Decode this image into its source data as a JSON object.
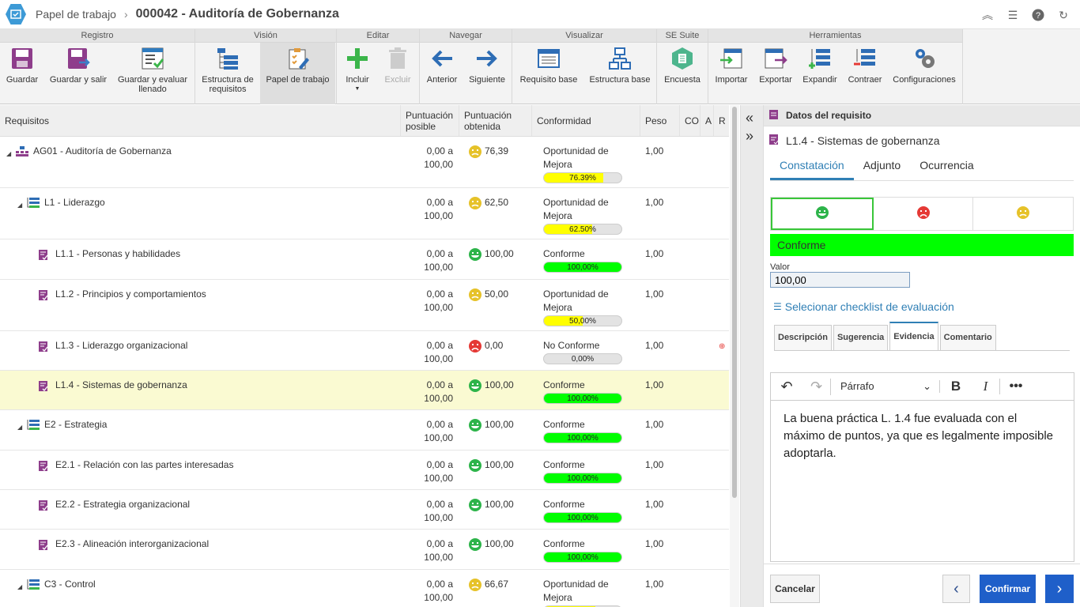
{
  "header": {
    "breadcrumb": "Papel de trabajo",
    "title": "000042 - Auditoría de Gobernanza"
  },
  "ribbon": {
    "groups": [
      "Registro",
      "Visión",
      "Editar",
      "Navegar",
      "Visualizar",
      "SE Suite",
      "Herramientas"
    ],
    "buttons": {
      "guardar": "Guardar",
      "guardar_salir": "Guardar y salir",
      "guardar_evaluar": "Guardar y evaluar llenado",
      "estructura": "Estructura de requisitos",
      "papel": "Papel de trabajo",
      "incluir": "Incluir",
      "excluir": "Excluir",
      "anterior": "Anterior",
      "siguiente": "Siguiente",
      "req_base": "Requisito base",
      "est_base": "Estructura base",
      "encuesta": "Encuesta",
      "importar": "Importar",
      "exportar": "Exportar",
      "expandir": "Expandir",
      "contraer": "Contraer",
      "config": "Configuraciones"
    }
  },
  "table": {
    "headers": {
      "req": "Requisitos",
      "pos": "Puntuación posible",
      "obt": "Puntuación obtenida",
      "conf": "Conformidad",
      "peso": "Peso",
      "co": "CO",
      "a": "A",
      "r": "R"
    },
    "rows": [
      {
        "name": "AG01 - Auditoría de Gobernanza",
        "pos_a": "0,00 a",
        "pos_b": "100,00",
        "obt": "76,39",
        "conf_a": "Oportunidad de",
        "conf_b": "Mejora",
        "pct": "76.39%",
        "peso": "1,00"
      },
      {
        "name": "L1 - Liderazgo",
        "pos_a": "0,00 a",
        "pos_b": "100,00",
        "obt": "62,50",
        "conf_a": "Oportunidad de",
        "conf_b": "Mejora",
        "pct": "62.50%",
        "peso": "1,00"
      },
      {
        "name": "L1.1 - Personas y habilidades",
        "pos_a": "0,00 a",
        "pos_b": "100,00",
        "obt": "100,00",
        "conf_a": "Conforme",
        "pct": "100,00%",
        "peso": "1,00"
      },
      {
        "name": "L1.2 - Principios y comportamientos",
        "pos_a": "0,00 a",
        "pos_b": "100,00",
        "obt": "50,00",
        "conf_a": "Oportunidad de",
        "conf_b": "Mejora",
        "pct": "50,00%",
        "peso": "1,00"
      },
      {
        "name": "L1.3 - Liderazgo organizacional",
        "pos_a": "0,00 a",
        "pos_b": "100,00",
        "obt": "0,00",
        "conf_a": "No Conforme",
        "pct": "0,00%",
        "peso": "1,00"
      },
      {
        "name": "L1.4 - Sistemas de gobernanza",
        "pos_a": "0,00 a",
        "pos_b": "100,00",
        "obt": "100,00",
        "conf_a": "Conforme",
        "pct": "100,00%",
        "peso": "1,00"
      },
      {
        "name": "E2 - Estrategia",
        "pos_a": "0,00 a",
        "pos_b": "100,00",
        "obt": "100,00",
        "conf_a": "Conforme",
        "pct": "100,00%",
        "peso": "1,00"
      },
      {
        "name": "E2.1 - Relación con las partes interesadas",
        "pos_a": "0,00 a",
        "pos_b": "100,00",
        "obt": "100,00",
        "conf_a": "Conforme",
        "pct": "100,00%",
        "peso": "1,00"
      },
      {
        "name": "E2.2 - Estrategia organizacional",
        "pos_a": "0,00 a",
        "pos_b": "100,00",
        "obt": "100,00",
        "conf_a": "Conforme",
        "pct": "100,00%",
        "peso": "1,00"
      },
      {
        "name": "E2.3 - Alineación interorganizacional",
        "pos_a": "0,00 a",
        "pos_b": "100,00",
        "obt": "100,00",
        "conf_a": "Conforme",
        "pct": "100,00%",
        "peso": "1,00"
      },
      {
        "name": "C3 - Control",
        "pos_a": "0,00 a",
        "pos_b": "100,00",
        "obt": "66,67",
        "conf_a": "Oportunidad de",
        "conf_b": "Mejora",
        "pct": "",
        "peso": "1,00"
      }
    ]
  },
  "panel": {
    "title": "Datos del requisito",
    "req": "L1.4 - Sistemas de gobernanza",
    "tabs": [
      "Constatación",
      "Adjunto",
      "Ocurrencia"
    ],
    "status": "Conforme",
    "valor_label": "Valor",
    "valor": "100,00",
    "checklist": "Selecionar checklist de evaluación",
    "subtabs": [
      "Descripción",
      "Sugerencia",
      "Evidencia",
      "Comentario"
    ],
    "format": "Párrafo",
    "evidence": "La buena práctica L. 1.4 fue evaluada con el máximo de puntos, ya que es legalmente imposible adoptarla.",
    "cancel": "Cancelar",
    "confirm": "Confirmar"
  },
  "colors": {
    "green": "#00ff00",
    "yellow": "#ffff00",
    "red": "#e53935",
    "accent": "#2f7fb5",
    "confirm": "#1f5fc9"
  }
}
